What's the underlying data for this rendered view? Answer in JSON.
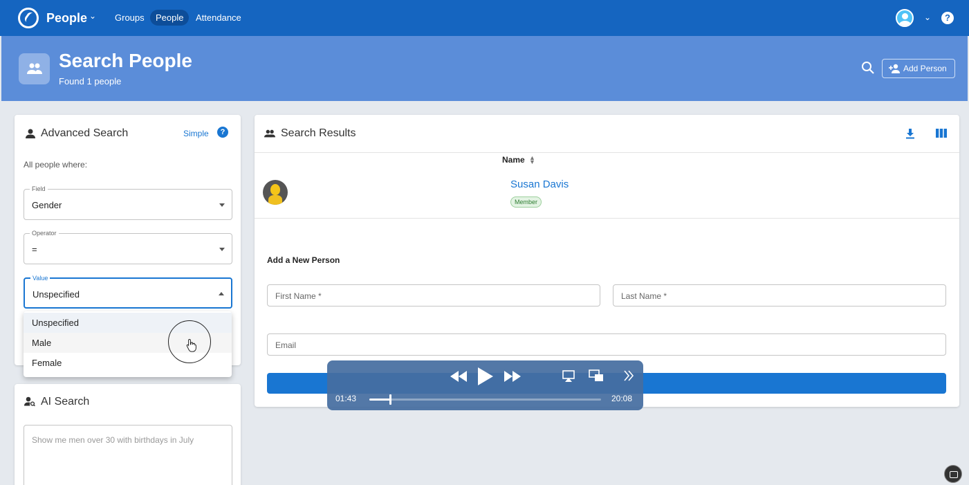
{
  "topbar": {
    "app_title": "People",
    "nav": [
      "Groups",
      "People",
      "Attendance"
    ],
    "help": "?"
  },
  "header": {
    "title": "Search People",
    "subtitle": "Found 1 people",
    "add_person_label": "Add Person"
  },
  "advanced_search": {
    "title": "Advanced Search",
    "simple_link": "Simple",
    "help": "?",
    "intro": "All people where:",
    "field": {
      "label": "Field",
      "value": "Gender"
    },
    "operator": {
      "label": "Operator",
      "value": "="
    },
    "value": {
      "label": "Value",
      "value": "Unspecified"
    },
    "options": [
      "Unspecified",
      "Male",
      "Female"
    ]
  },
  "ai_search": {
    "title": "AI Search",
    "placeholder": "Show me men over 30 with birthdays in July"
  },
  "results": {
    "title": "Search Results",
    "column_name": "Name",
    "rows": [
      {
        "name": "Susan Davis",
        "badge": "Member"
      }
    ]
  },
  "add_new": {
    "title": "Add a New Person",
    "first_name_placeholder": "First Name *",
    "last_name_placeholder": "Last Name *",
    "email_placeholder": "Email"
  },
  "player": {
    "elapsed": "01:43",
    "total": "20:08",
    "progress": 0.09
  },
  "colors": {
    "nav_bg": "#1565c0",
    "header_bg": "#5b8dd9",
    "accent": "#1976d2"
  }
}
